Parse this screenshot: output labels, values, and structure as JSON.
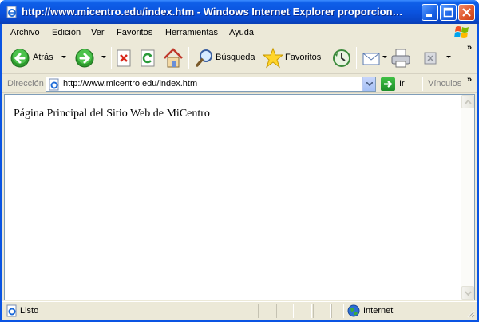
{
  "window": {
    "title": "http://www.micentro.edu/index.htm - Windows Internet Explorer proporcion…"
  },
  "menu": {
    "items": [
      {
        "label": "Archivo"
      },
      {
        "label": "Edición"
      },
      {
        "label": "Ver"
      },
      {
        "label": "Favoritos"
      },
      {
        "label": "Herramientas"
      },
      {
        "label": "Ayuda"
      }
    ]
  },
  "toolbar": {
    "back_label": "Atrás",
    "search_label": "Búsqueda",
    "favorites_label": "Favoritos",
    "overflow": "»"
  },
  "address": {
    "label": "Dirección",
    "url": "http://www.micentro.edu/index.htm",
    "go_label": "Ir",
    "links_label": "Vínculos",
    "overflow": "»"
  },
  "page": {
    "text": "Página Principal del Sitio Web de MiCentro"
  },
  "status": {
    "text": "Listo",
    "zone": "Internet"
  },
  "colors": {
    "titlebar": "#0a53df",
    "chrome": "#ece9d8",
    "close_button": "#e05a2e"
  }
}
